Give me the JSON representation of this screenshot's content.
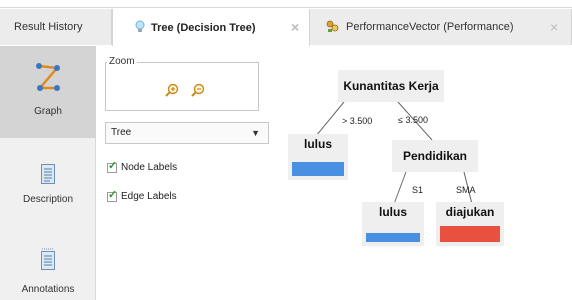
{
  "tabs": [
    {
      "label": "Result History"
    },
    {
      "label": "Tree (Decision Tree)",
      "close": "×"
    },
    {
      "label": "PerformanceVector (Performance)",
      "close": "×"
    }
  ],
  "sidebar": {
    "items": [
      {
        "label": "Graph",
        "icon": "graph-icon",
        "active": true
      },
      {
        "label": "Description",
        "icon": "description-icon"
      },
      {
        "label": "Annotations",
        "icon": "annotations-icon"
      }
    ]
  },
  "panel": {
    "zoom_label": "Zoom",
    "layout_select": {
      "value": "Tree"
    },
    "node_labels": {
      "label": "Node Labels",
      "checked": true
    },
    "edge_labels": {
      "label": "Edge Labels",
      "checked": true
    }
  },
  "tree": {
    "root": "Kunantitas Kerja",
    "edge_left": "> 3.500",
    "edge_right": "≤ 3.500",
    "leaf_left": "lulus",
    "child": "Pendidikan",
    "edge_s1": "S1",
    "edge_sma": "SMA",
    "leaf_s1": "lulus",
    "leaf_sma": "diajukan"
  },
  "colors": {
    "lulus": "#4a90e2",
    "diajukan": "#e8503f",
    "active_sidebar": "#d4d4d4"
  }
}
